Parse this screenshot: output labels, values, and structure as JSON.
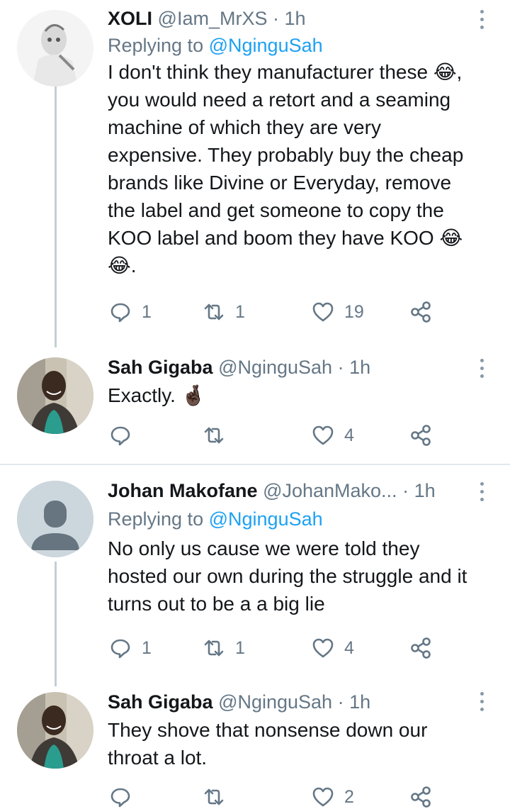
{
  "tweets": [
    {
      "name": "XOLI",
      "handle": "@Iam_MrXS",
      "time": "· 1h",
      "reply_label": "Replying to",
      "reply_to": "@NginguSah",
      "text": "I don't think they manufacturer these 😂, you would need a retort and a seaming machine of which they are very expensive.  They probably buy the cheap brands like Divine or Everyday, remove the label and get someone to copy the KOO label and boom they have KOO 😂😂.",
      "replies": "1",
      "retweets": "1",
      "likes": "19"
    },
    {
      "name": "Sah Gigaba",
      "handle": "@NginguSah",
      "time": "· 1h",
      "text": "Exactly. 🤞🏿",
      "replies": "",
      "retweets": "",
      "likes": "4"
    },
    {
      "name": "Johan Makofane",
      "handle": "@JohanMako...",
      "time": "· 1h",
      "reply_label": "Replying to",
      "reply_to": "@NginguSah",
      "text": "No only us cause we were told they hosted our own during the struggle and it turns out to be a a big lie",
      "replies": "1",
      "retweets": "1",
      "likes": "4"
    },
    {
      "name": "Sah Gigaba",
      "handle": "@NginguSah",
      "time": "· 1h",
      "text": "They shove that nonsense down our throat a lot.",
      "replies": "",
      "retweets": "",
      "likes": "2"
    }
  ],
  "icons": {
    "reply": "reply-icon",
    "retweet": "retweet-icon",
    "like": "heart-icon",
    "share": "share-icon",
    "more": "more-vertical-icon"
  },
  "colors": {
    "text": "#14171a",
    "secondary": "#657786",
    "link": "#1da1f2",
    "divider": "#e1e8ed",
    "thread_line": "#c4cfd6"
  }
}
